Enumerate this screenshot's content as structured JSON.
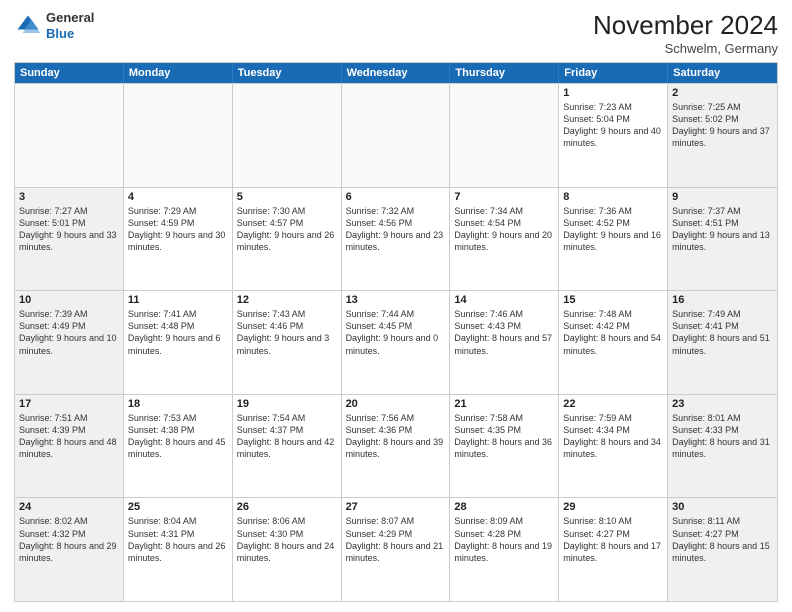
{
  "logo": {
    "general": "General",
    "blue": "Blue"
  },
  "title": "November 2024",
  "location": "Schwelm, Germany",
  "header_days": [
    "Sunday",
    "Monday",
    "Tuesday",
    "Wednesday",
    "Thursday",
    "Friday",
    "Saturday"
  ],
  "weeks": [
    [
      {
        "day": "",
        "text": ""
      },
      {
        "day": "",
        "text": ""
      },
      {
        "day": "",
        "text": ""
      },
      {
        "day": "",
        "text": ""
      },
      {
        "day": "",
        "text": ""
      },
      {
        "day": "1",
        "text": "Sunrise: 7:23 AM\nSunset: 5:04 PM\nDaylight: 9 hours and 40 minutes."
      },
      {
        "day": "2",
        "text": "Sunrise: 7:25 AM\nSunset: 5:02 PM\nDaylight: 9 hours and 37 minutes."
      }
    ],
    [
      {
        "day": "3",
        "text": "Sunrise: 7:27 AM\nSunset: 5:01 PM\nDaylight: 9 hours and 33 minutes."
      },
      {
        "day": "4",
        "text": "Sunrise: 7:29 AM\nSunset: 4:59 PM\nDaylight: 9 hours and 30 minutes."
      },
      {
        "day": "5",
        "text": "Sunrise: 7:30 AM\nSunset: 4:57 PM\nDaylight: 9 hours and 26 minutes."
      },
      {
        "day": "6",
        "text": "Sunrise: 7:32 AM\nSunset: 4:56 PM\nDaylight: 9 hours and 23 minutes."
      },
      {
        "day": "7",
        "text": "Sunrise: 7:34 AM\nSunset: 4:54 PM\nDaylight: 9 hours and 20 minutes."
      },
      {
        "day": "8",
        "text": "Sunrise: 7:36 AM\nSunset: 4:52 PM\nDaylight: 9 hours and 16 minutes."
      },
      {
        "day": "9",
        "text": "Sunrise: 7:37 AM\nSunset: 4:51 PM\nDaylight: 9 hours and 13 minutes."
      }
    ],
    [
      {
        "day": "10",
        "text": "Sunrise: 7:39 AM\nSunset: 4:49 PM\nDaylight: 9 hours and 10 minutes."
      },
      {
        "day": "11",
        "text": "Sunrise: 7:41 AM\nSunset: 4:48 PM\nDaylight: 9 hours and 6 minutes."
      },
      {
        "day": "12",
        "text": "Sunrise: 7:43 AM\nSunset: 4:46 PM\nDaylight: 9 hours and 3 minutes."
      },
      {
        "day": "13",
        "text": "Sunrise: 7:44 AM\nSunset: 4:45 PM\nDaylight: 9 hours and 0 minutes."
      },
      {
        "day": "14",
        "text": "Sunrise: 7:46 AM\nSunset: 4:43 PM\nDaylight: 8 hours and 57 minutes."
      },
      {
        "day": "15",
        "text": "Sunrise: 7:48 AM\nSunset: 4:42 PM\nDaylight: 8 hours and 54 minutes."
      },
      {
        "day": "16",
        "text": "Sunrise: 7:49 AM\nSunset: 4:41 PM\nDaylight: 8 hours and 51 minutes."
      }
    ],
    [
      {
        "day": "17",
        "text": "Sunrise: 7:51 AM\nSunset: 4:39 PM\nDaylight: 8 hours and 48 minutes."
      },
      {
        "day": "18",
        "text": "Sunrise: 7:53 AM\nSunset: 4:38 PM\nDaylight: 8 hours and 45 minutes."
      },
      {
        "day": "19",
        "text": "Sunrise: 7:54 AM\nSunset: 4:37 PM\nDaylight: 8 hours and 42 minutes."
      },
      {
        "day": "20",
        "text": "Sunrise: 7:56 AM\nSunset: 4:36 PM\nDaylight: 8 hours and 39 minutes."
      },
      {
        "day": "21",
        "text": "Sunrise: 7:58 AM\nSunset: 4:35 PM\nDaylight: 8 hours and 36 minutes."
      },
      {
        "day": "22",
        "text": "Sunrise: 7:59 AM\nSunset: 4:34 PM\nDaylight: 8 hours and 34 minutes."
      },
      {
        "day": "23",
        "text": "Sunrise: 8:01 AM\nSunset: 4:33 PM\nDaylight: 8 hours and 31 minutes."
      }
    ],
    [
      {
        "day": "24",
        "text": "Sunrise: 8:02 AM\nSunset: 4:32 PM\nDaylight: 8 hours and 29 minutes."
      },
      {
        "day": "25",
        "text": "Sunrise: 8:04 AM\nSunset: 4:31 PM\nDaylight: 8 hours and 26 minutes."
      },
      {
        "day": "26",
        "text": "Sunrise: 8:06 AM\nSunset: 4:30 PM\nDaylight: 8 hours and 24 minutes."
      },
      {
        "day": "27",
        "text": "Sunrise: 8:07 AM\nSunset: 4:29 PM\nDaylight: 8 hours and 21 minutes."
      },
      {
        "day": "28",
        "text": "Sunrise: 8:09 AM\nSunset: 4:28 PM\nDaylight: 8 hours and 19 minutes."
      },
      {
        "day": "29",
        "text": "Sunrise: 8:10 AM\nSunset: 4:27 PM\nDaylight: 8 hours and 17 minutes."
      },
      {
        "day": "30",
        "text": "Sunrise: 8:11 AM\nSunset: 4:27 PM\nDaylight: 8 hours and 15 minutes."
      }
    ]
  ]
}
